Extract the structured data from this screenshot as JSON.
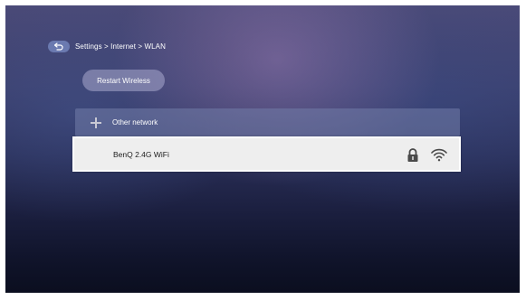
{
  "breadcrumb": {
    "back_icon": "back-arrow-icon",
    "text": "Settings > Internet > WLAN"
  },
  "actions": {
    "restart_label": "Restart Wireless"
  },
  "networks": {
    "other": {
      "icon": "plus-icon",
      "label": "Other network"
    },
    "items": [
      {
        "name": "BenQ 2.4G WiFi",
        "secured": true,
        "lock_icon": "lock-icon",
        "signal_icon": "wifi-signal-icon",
        "selected": true
      }
    ]
  },
  "colors": {
    "selected_row": "#eeeeee",
    "text_light": "#ffffff",
    "text_dark": "#1c1c1c"
  }
}
